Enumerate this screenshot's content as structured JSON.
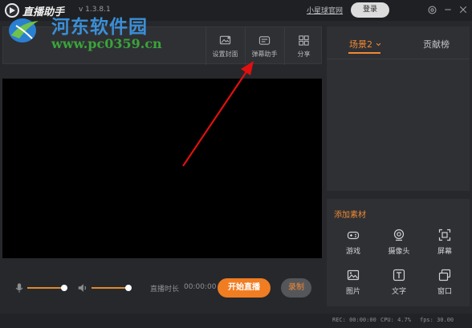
{
  "titlebar": {
    "app_name": "直播助手",
    "version": "v 1.3.8.1",
    "site_link": "小星球官网",
    "login_label": "登录",
    "icons": [
      "settings-icon",
      "minimize-icon",
      "close-icon"
    ]
  },
  "watermark": {
    "brand": "河东软件园",
    "url": "www.pc0359.cn"
  },
  "toolbar": {
    "items": [
      {
        "label": "设置封面",
        "icon": "cover-image-icon"
      },
      {
        "label": "弹幕助手",
        "icon": "danmaku-icon"
      },
      {
        "label": "分享",
        "icon": "qrcode-icon"
      }
    ]
  },
  "controls": {
    "mic_level": 1.0,
    "speaker_level": 1.0,
    "duration_label": "直播时长",
    "duration_value": "00:00:00",
    "start_label": "开始直播",
    "record_label": "录制"
  },
  "scenes": {
    "tabs": [
      {
        "label": "场景2",
        "active": true
      },
      {
        "label": "贡献榜",
        "active": false
      }
    ]
  },
  "materials": {
    "title": "添加素材",
    "items": [
      {
        "label": "游戏",
        "icon": "gamepad-icon"
      },
      {
        "label": "摄像头",
        "icon": "camera-icon"
      },
      {
        "label": "屏幕",
        "icon": "screen-capture-icon"
      },
      {
        "label": "图片",
        "icon": "image-icon"
      },
      {
        "label": "文字",
        "icon": "text-icon"
      },
      {
        "label": "窗口",
        "icon": "window-icon"
      }
    ]
  },
  "status": {
    "rec": "REC: 00:00:00",
    "cpu": "CPU: 4.7%",
    "fps": "fps: 30.00"
  },
  "colors": {
    "accent": "#f07d22",
    "background": "#27282c",
    "panel": "#2f3034",
    "annotation": "#e01010"
  }
}
